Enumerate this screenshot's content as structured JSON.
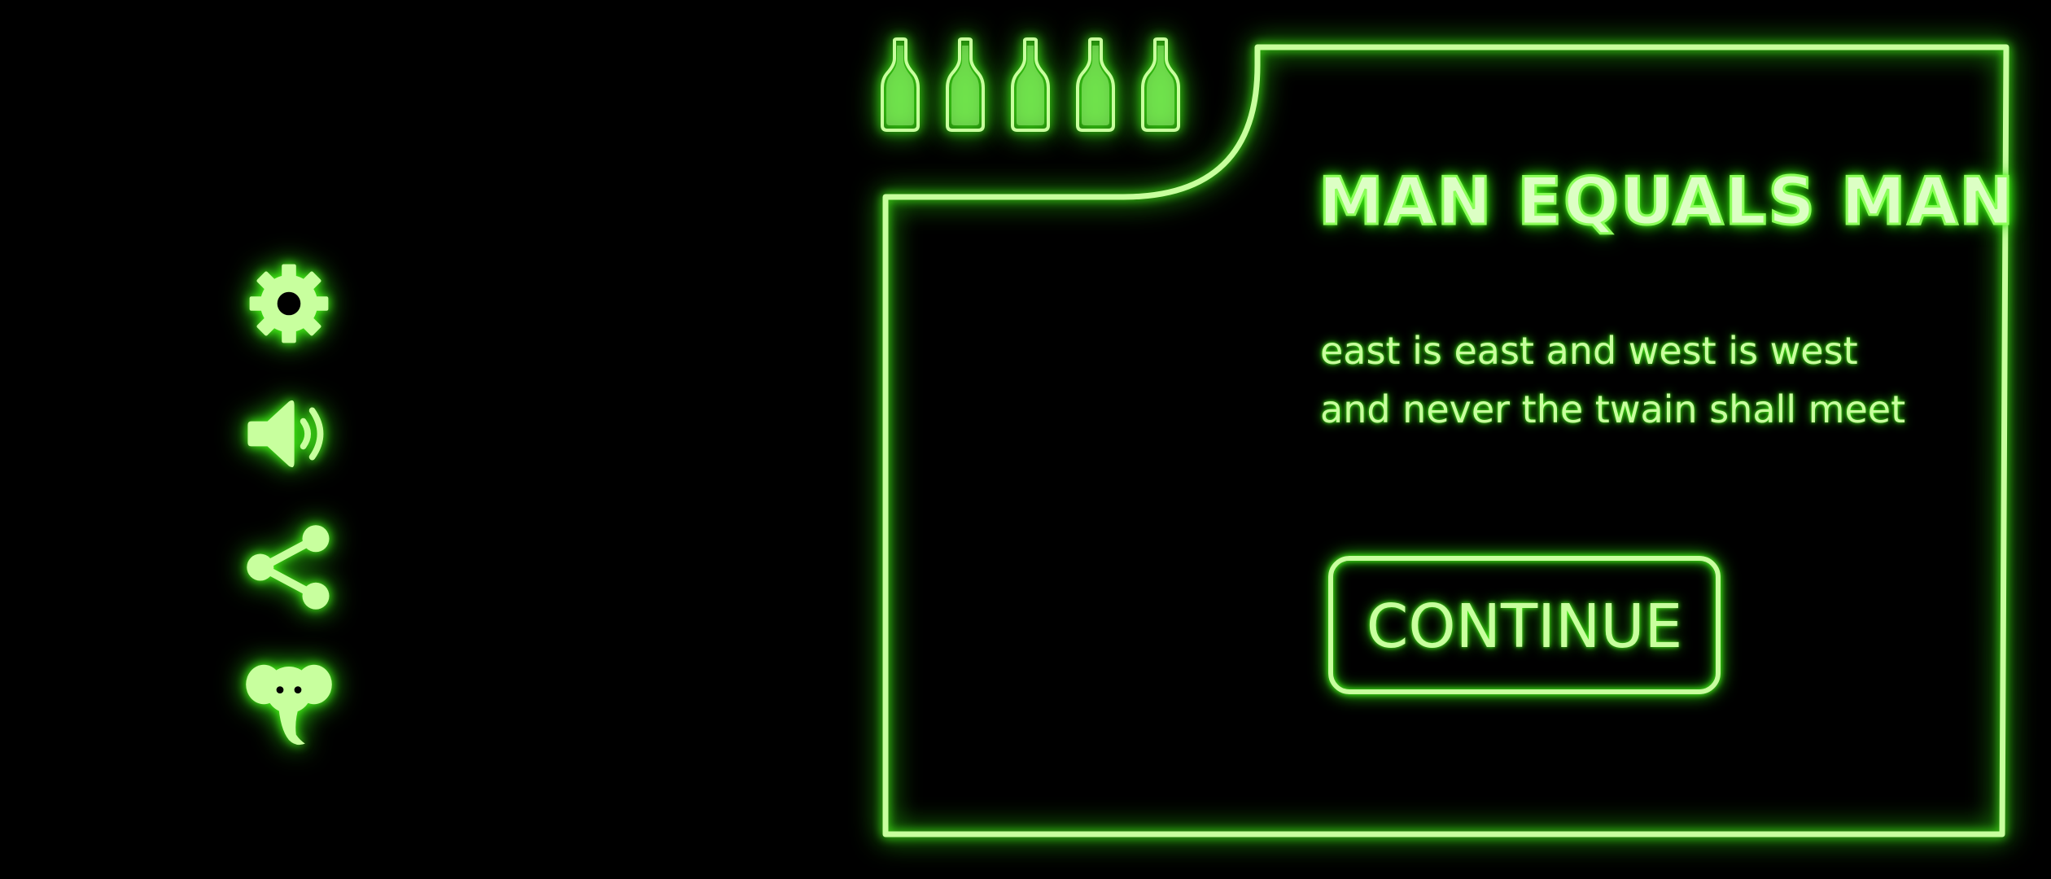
{
  "game": {
    "title": "MAN EQUALS MAN",
    "message_lines": [
      "east is east and west is west",
      "and never the twain shall meet"
    ],
    "continue_label": "CONTINUE",
    "bottles_remaining": 5,
    "bottles_total": 5
  },
  "side_menu": {
    "icons": [
      "gear-icon",
      "speaker-icon",
      "share-icon",
      "elephant-icon"
    ]
  },
  "colors": {
    "neon_core": "#c8ff9e",
    "neon_glow": "#4cff1a",
    "background": "#000000"
  }
}
